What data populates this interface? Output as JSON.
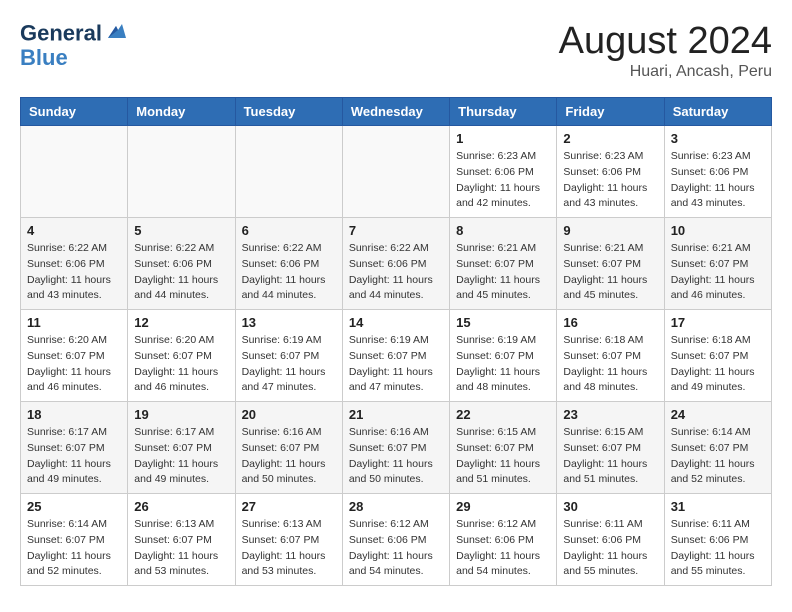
{
  "header": {
    "logo_line1": "General",
    "logo_line2": "Blue",
    "month_year": "August 2024",
    "location": "Huari, Ancash, Peru"
  },
  "weekdays": [
    "Sunday",
    "Monday",
    "Tuesday",
    "Wednesday",
    "Thursday",
    "Friday",
    "Saturday"
  ],
  "weeks": [
    [
      {
        "day": "",
        "content": ""
      },
      {
        "day": "",
        "content": ""
      },
      {
        "day": "",
        "content": ""
      },
      {
        "day": "",
        "content": ""
      },
      {
        "day": "1",
        "content": "Sunrise: 6:23 AM\nSunset: 6:06 PM\nDaylight: 11 hours\nand 42 minutes."
      },
      {
        "day": "2",
        "content": "Sunrise: 6:23 AM\nSunset: 6:06 PM\nDaylight: 11 hours\nand 43 minutes."
      },
      {
        "day": "3",
        "content": "Sunrise: 6:23 AM\nSunset: 6:06 PM\nDaylight: 11 hours\nand 43 minutes."
      }
    ],
    [
      {
        "day": "4",
        "content": "Sunrise: 6:22 AM\nSunset: 6:06 PM\nDaylight: 11 hours\nand 43 minutes."
      },
      {
        "day": "5",
        "content": "Sunrise: 6:22 AM\nSunset: 6:06 PM\nDaylight: 11 hours\nand 44 minutes."
      },
      {
        "day": "6",
        "content": "Sunrise: 6:22 AM\nSunset: 6:06 PM\nDaylight: 11 hours\nand 44 minutes."
      },
      {
        "day": "7",
        "content": "Sunrise: 6:22 AM\nSunset: 6:06 PM\nDaylight: 11 hours\nand 44 minutes."
      },
      {
        "day": "8",
        "content": "Sunrise: 6:21 AM\nSunset: 6:07 PM\nDaylight: 11 hours\nand 45 minutes."
      },
      {
        "day": "9",
        "content": "Sunrise: 6:21 AM\nSunset: 6:07 PM\nDaylight: 11 hours\nand 45 minutes."
      },
      {
        "day": "10",
        "content": "Sunrise: 6:21 AM\nSunset: 6:07 PM\nDaylight: 11 hours\nand 46 minutes."
      }
    ],
    [
      {
        "day": "11",
        "content": "Sunrise: 6:20 AM\nSunset: 6:07 PM\nDaylight: 11 hours\nand 46 minutes."
      },
      {
        "day": "12",
        "content": "Sunrise: 6:20 AM\nSunset: 6:07 PM\nDaylight: 11 hours\nand 46 minutes."
      },
      {
        "day": "13",
        "content": "Sunrise: 6:19 AM\nSunset: 6:07 PM\nDaylight: 11 hours\nand 47 minutes."
      },
      {
        "day": "14",
        "content": "Sunrise: 6:19 AM\nSunset: 6:07 PM\nDaylight: 11 hours\nand 47 minutes."
      },
      {
        "day": "15",
        "content": "Sunrise: 6:19 AM\nSunset: 6:07 PM\nDaylight: 11 hours\nand 48 minutes."
      },
      {
        "day": "16",
        "content": "Sunrise: 6:18 AM\nSunset: 6:07 PM\nDaylight: 11 hours\nand 48 minutes."
      },
      {
        "day": "17",
        "content": "Sunrise: 6:18 AM\nSunset: 6:07 PM\nDaylight: 11 hours\nand 49 minutes."
      }
    ],
    [
      {
        "day": "18",
        "content": "Sunrise: 6:17 AM\nSunset: 6:07 PM\nDaylight: 11 hours\nand 49 minutes."
      },
      {
        "day": "19",
        "content": "Sunrise: 6:17 AM\nSunset: 6:07 PM\nDaylight: 11 hours\nand 49 minutes."
      },
      {
        "day": "20",
        "content": "Sunrise: 6:16 AM\nSunset: 6:07 PM\nDaylight: 11 hours\nand 50 minutes."
      },
      {
        "day": "21",
        "content": "Sunrise: 6:16 AM\nSunset: 6:07 PM\nDaylight: 11 hours\nand 50 minutes."
      },
      {
        "day": "22",
        "content": "Sunrise: 6:15 AM\nSunset: 6:07 PM\nDaylight: 11 hours\nand 51 minutes."
      },
      {
        "day": "23",
        "content": "Sunrise: 6:15 AM\nSunset: 6:07 PM\nDaylight: 11 hours\nand 51 minutes."
      },
      {
        "day": "24",
        "content": "Sunrise: 6:14 AM\nSunset: 6:07 PM\nDaylight: 11 hours\nand 52 minutes."
      }
    ],
    [
      {
        "day": "25",
        "content": "Sunrise: 6:14 AM\nSunset: 6:07 PM\nDaylight: 11 hours\nand 52 minutes."
      },
      {
        "day": "26",
        "content": "Sunrise: 6:13 AM\nSunset: 6:07 PM\nDaylight: 11 hours\nand 53 minutes."
      },
      {
        "day": "27",
        "content": "Sunrise: 6:13 AM\nSunset: 6:07 PM\nDaylight: 11 hours\nand 53 minutes."
      },
      {
        "day": "28",
        "content": "Sunrise: 6:12 AM\nSunset: 6:06 PM\nDaylight: 11 hours\nand 54 minutes."
      },
      {
        "day": "29",
        "content": "Sunrise: 6:12 AM\nSunset: 6:06 PM\nDaylight: 11 hours\nand 54 minutes."
      },
      {
        "day": "30",
        "content": "Sunrise: 6:11 AM\nSunset: 6:06 PM\nDaylight: 11 hours\nand 55 minutes."
      },
      {
        "day": "31",
        "content": "Sunrise: 6:11 AM\nSunset: 6:06 PM\nDaylight: 11 hours\nand 55 minutes."
      }
    ]
  ]
}
